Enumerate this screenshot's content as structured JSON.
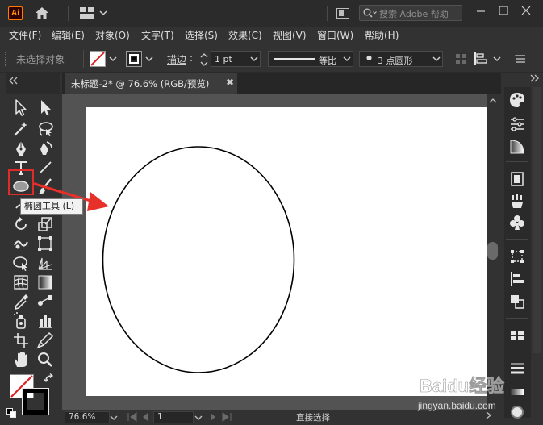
{
  "app": {
    "logo_text": "Ai",
    "search_placeholder": "搜索 Adobe 帮助"
  },
  "menu": {
    "items": [
      "文件(F)",
      "编辑(E)",
      "对象(O)",
      "文字(T)",
      "选择(S)",
      "效果(C)",
      "视图(V)",
      "窗口(W)",
      "帮助(H)"
    ]
  },
  "controlbar": {
    "selection_status": "未选择对象",
    "stroke_label": "描边",
    "stroke_weight": "1 pt",
    "uniform_label": "等比",
    "brush_label": "3 点圆形"
  },
  "document": {
    "tab_title": "未标题-2* @ 76.6% (RGB/预览)",
    "close_glyph": "✖"
  },
  "tools": {
    "tooltip": "椭圆工具 (L)"
  },
  "status": {
    "zoom": "76.6%",
    "artboard_index": "1",
    "current_tool": "直接选择"
  },
  "watermark": {
    "text": "Baidu经验",
    "url": "jingyan.baidu.com"
  },
  "colors": {
    "highlight": "#e02b2b",
    "arrow": "#e8302a",
    "artboard": "#ffffff"
  }
}
